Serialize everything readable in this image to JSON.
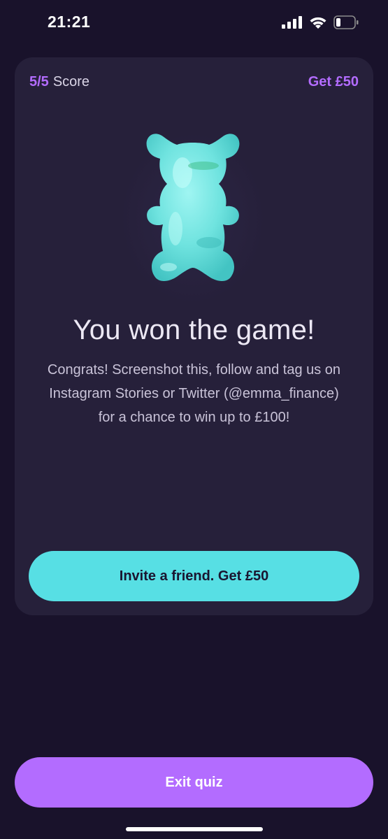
{
  "status_bar": {
    "time": "21:21",
    "signal_icon": "cellular-signal-icon",
    "wifi_icon": "wifi-icon",
    "battery_icon": "battery-icon",
    "battery_level": 0.2
  },
  "card": {
    "score_value": "5/5",
    "score_label": "Score",
    "get_reward": "Get £50",
    "illustration": "gummy-bear-icon",
    "headline": "You won the game!",
    "body": "Congrats! Screenshot this, follow and tag us on Instagram Stories or Twitter (@emma_finance) for a chance to win up to £100!",
    "invite_button_label": "Invite a friend. Get £50"
  },
  "footer": {
    "exit_button_label": "Exit quiz"
  },
  "colors": {
    "background": "#19122b",
    "card": "#26203a",
    "accent_purple": "#b36cff",
    "accent_cyan": "#57dfe4"
  }
}
